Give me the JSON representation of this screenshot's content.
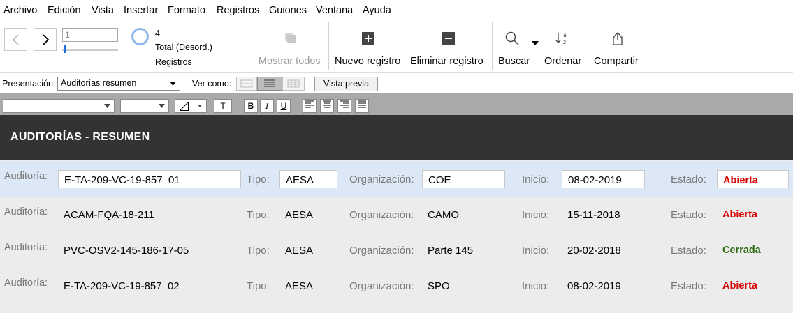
{
  "menu": [
    "Archivo",
    "Edición",
    "Vista",
    "Insertar",
    "Formato",
    "Registros",
    "Guiones",
    "Ventana",
    "Ayuda"
  ],
  "toolbar": {
    "record_number": "1",
    "total_count": "4",
    "total_label": "Total (Desord.)",
    "records_label": "Registros",
    "show_all": "Mostrar todos",
    "new_record": "Nuevo registro",
    "delete_record": "Eliminar registro",
    "find": "Buscar",
    "sort": "Ordenar",
    "share": "Compartir"
  },
  "layoutbar": {
    "layout_label": "Presentación:",
    "layout_value": "Auditorías resumen",
    "view_as_label": "Ver como:",
    "preview_button": "Vista previa"
  },
  "format": {
    "bold": "B",
    "italic": "I",
    "underline": "U",
    "text": "T"
  },
  "header": {
    "title": "AUDITORÍAS - RESUMEN"
  },
  "field_labels": {
    "audit": "Auditoría:",
    "type": "Tipo:",
    "org": "Organización:",
    "start": "Inicio:",
    "status": "Estado:"
  },
  "colors": {
    "open": "#d40000",
    "closed": "#2e6b12",
    "header_bg": "#333333",
    "selected_row": "#dce8f6",
    "accent": "#1f6fe0"
  },
  "records": [
    {
      "audit": "E-TA-209-VC-19-857_01",
      "type": "AESA",
      "org": "COE",
      "start": "08-02-2019",
      "status": "Abierta"
    },
    {
      "audit": "ACAM-FQA-18-211",
      "type": "AESA",
      "org": "CAMO",
      "start": "15-11-2018",
      "status": "Abierta"
    },
    {
      "audit": "PVC-OSV2-145-186-17-05",
      "type": "AESA",
      "org": "Parte 145",
      "start": "20-02-2018",
      "status": "Cerrada"
    },
    {
      "audit": "E-TA-209-VC-19-857_02",
      "type": "AESA",
      "org": "SPO",
      "start": "08-02-2019",
      "status": "Abierta"
    }
  ]
}
